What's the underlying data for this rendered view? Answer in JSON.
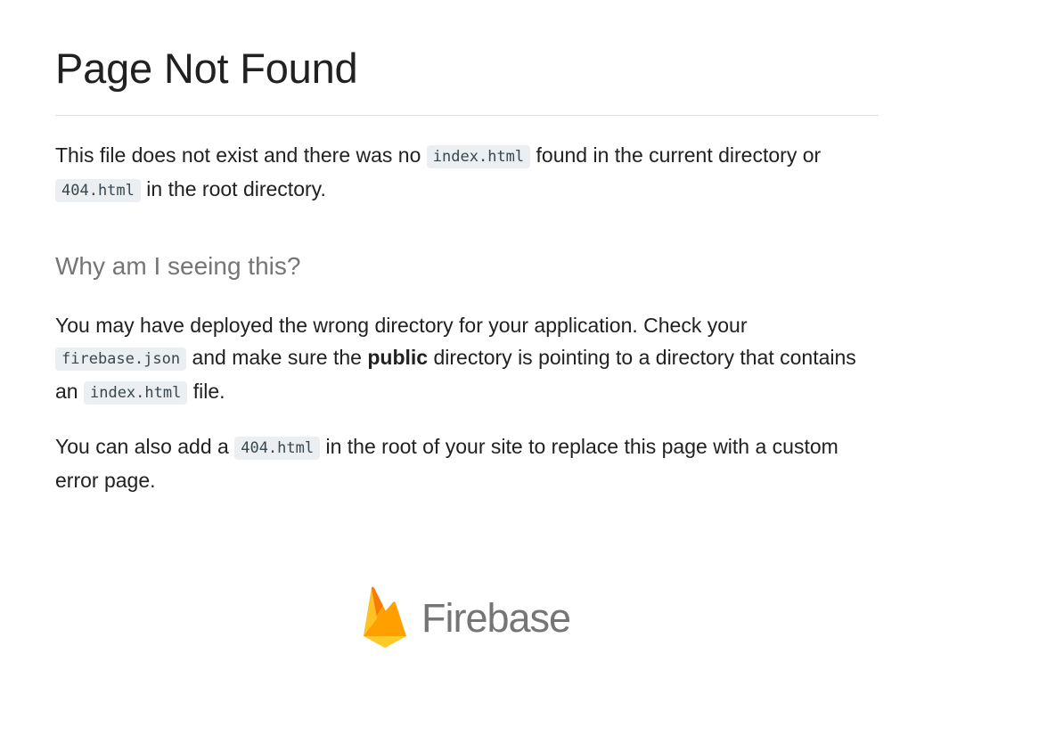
{
  "page": {
    "title": "Page Not Found",
    "intro": {
      "t1": "This file does not exist and there was no ",
      "code1": "index.html",
      "t2": " found in the current directory or ",
      "code2": "404.html",
      "t3": " in the root directory."
    },
    "why_heading": "Why am I seeing this?",
    "why": {
      "t1": "You may have deployed the wrong directory for your application. Check your ",
      "code1": "firebase.json",
      "t2": " and make sure the ",
      "bold": "public",
      "t3": " directory is pointing to a directory that contains an ",
      "code2": "index.html",
      "t4": " file."
    },
    "also": {
      "t1": "You can also add a ",
      "code1": "404.html",
      "t2": " in the root of your site to replace this page with a custom error page."
    }
  },
  "footer": {
    "logo_text": "Firebase",
    "logo_icon": "firebase-flame-icon",
    "colors": {
      "flame_dark": "#f57c00",
      "flame_light": "#ffca28",
      "flame_mid": "#ffa000"
    }
  }
}
